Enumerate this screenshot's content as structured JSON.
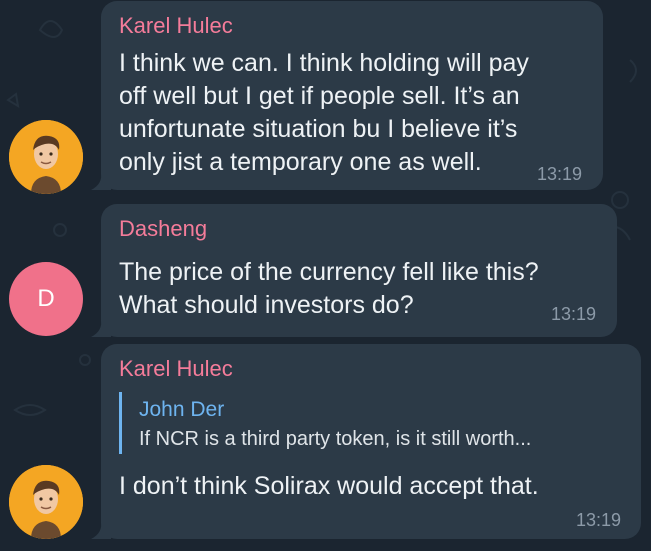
{
  "colors": {
    "background": "#1b2530",
    "bubble": "#2c3a47",
    "sender_name": "#f57c9a",
    "reply_accent": "#6eb4f0",
    "timestamp": "#8c9aa8",
    "avatar_letter_bg": "#f0718a",
    "avatar_photo_bg": "#f4a623"
  },
  "messages": [
    {
      "sender": "Karel Hulec",
      "avatar": "photo",
      "lines": [
        "I think we can. I think holding will pay",
        "off well but I get if people sell. It’s an",
        "unfortunate situation bu I believe it’s",
        "only jist a temporary one as well."
      ],
      "time": "13:19"
    },
    {
      "sender": "Dasheng",
      "avatar": "letter",
      "avatar_letter": "D",
      "lines": [
        "The price of the currency fell like this?",
        "What should investors do?"
      ],
      "time": "13:19"
    },
    {
      "sender": "Karel Hulec",
      "avatar": "photo",
      "reply": {
        "name": "John Der",
        "text": "If NCR is a third party token, is it still worth..."
      },
      "lines": [
        "I don’t think Solirax would accept that."
      ],
      "time": "13:19"
    }
  ]
}
